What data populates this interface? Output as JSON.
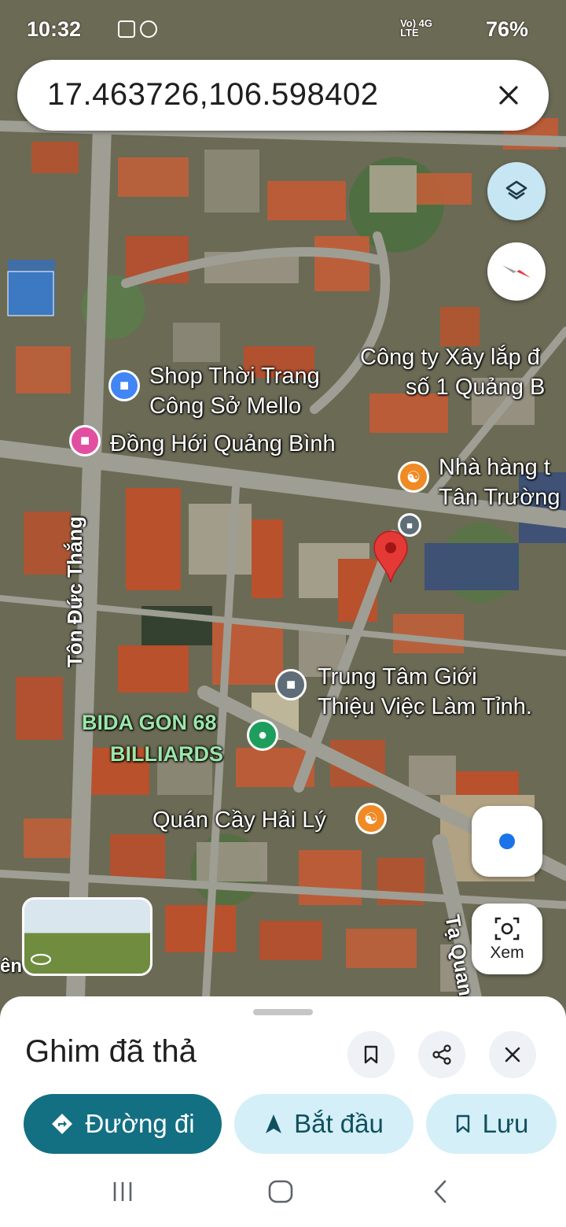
{
  "status_bar": {
    "time": "10:32",
    "network": "Vo) 4G\nLTE",
    "battery": "76%"
  },
  "search": {
    "query": "17.463726,106.598402"
  },
  "map": {
    "roads": {
      "ton_duc_thang": "Tôn Đức Thắng",
      "ta_quang": "Tạ Quang",
      "edge_left": "ên"
    },
    "pois": {
      "shop": [
        "Shop Thời Trang",
        "Công Sở Mello"
      ],
      "hotel": "Đồng Hới Quảng Bình",
      "company": [
        "Công ty Xây lắp đ",
        "số 1 Quảng B"
      ],
      "restaurant": [
        "Nhà hàng t",
        "Tân Trường"
      ],
      "job_center": [
        "Trung Tâm Giới",
        "Thiệu Việc Làm Tỉnh."
      ],
      "billiards": [
        "BIDA GON 68",
        "BILLIARDS"
      ],
      "eatery": "Quán Cầy Hải Lý"
    },
    "pin_color": "#e53935",
    "lens_label": "Xem"
  },
  "sheet": {
    "title": "Ghim đã thả",
    "directions_label": "Đường đi",
    "start_label": "Bắt đầu",
    "save_label": "Lưu",
    "accent": "#136f82"
  }
}
